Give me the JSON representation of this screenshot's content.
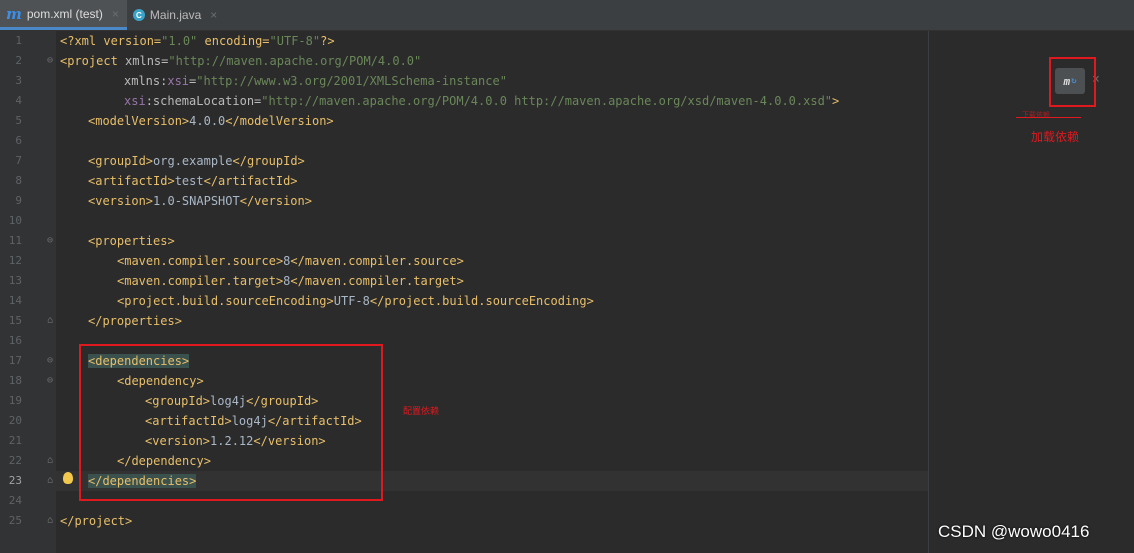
{
  "tabs": [
    {
      "label": "pom.xml (test)",
      "icon": "m"
    },
    {
      "label": "Main.java",
      "icon": "C"
    }
  ],
  "line_numbers": [
    "1",
    "2",
    "3",
    "4",
    "5",
    "6",
    "7",
    "8",
    "9",
    "10",
    "11",
    "12",
    "13",
    "14",
    "15",
    "16",
    "17",
    "18",
    "19",
    "20",
    "21",
    "22",
    "23",
    "24",
    "25"
  ],
  "code": {
    "l1_a": "<?xml version=",
    "l1_b": "\"1.0\"",
    "l1_c": " encoding=",
    "l1_d": "\"UTF-8\"",
    "l1_e": "?>",
    "l2_a": "<project ",
    "l2_b": "xmlns=",
    "l2_c": "\"http://maven.apache.org/POM/4.0.0\"",
    "l3_a": "xmlns:",
    "l3_b": "xsi",
    "l3_c": "=",
    "l3_d": "\"http://www.w3.org/2001/XMLSchema-instance\"",
    "l4_a": "xsi",
    "l4_b": ":schemaLocation=",
    "l4_c": "\"http://maven.apache.org/POM/4.0.0 http://maven.apache.org/xsd/maven-4.0.0.xsd\"",
    "l4_d": ">",
    "l5_a": "<modelVersion>",
    "l5_b": "4.0.0",
    "l5_c": "</modelVersion>",
    "l7_a": "<groupId>",
    "l7_b": "org.example",
    "l7_c": "</groupId>",
    "l8_a": "<artifactId>",
    "l8_b": "test",
    "l8_c": "</artifactId>",
    "l9_a": "<version>",
    "l9_b": "1.0-SNAPSHOT",
    "l9_c": "</version>",
    "l11": "<properties>",
    "l12_a": "<maven.compiler.source>",
    "l12_b": "8",
    "l12_c": "</maven.compiler.source>",
    "l13_a": "<maven.compiler.target>",
    "l13_b": "8",
    "l13_c": "</maven.compiler.target>",
    "l14_a": "<project.build.sourceEncoding>",
    "l14_b": "UTF-8",
    "l14_c": "</project.build.sourceEncoding>",
    "l15": "</properties>",
    "l17": "<dependencies>",
    "l18": "<dependency>",
    "l19_a": "<groupId>",
    "l19_b": "log4j",
    "l19_c": "</groupId>",
    "l20_a": "<artifactId>",
    "l20_b": "log4j",
    "l20_c": "</artifactId>",
    "l21_a": "<version>",
    "l21_b": "1.2.12",
    "l21_c": "</version>",
    "l22": "</dependency>",
    "l23": "</dependencies>",
    "l25": "</project>"
  },
  "annotations": {
    "config_deps": "配置依赖",
    "load_deps": "加载依赖",
    "load_deps_small": "下载依赖"
  },
  "maven_button": {
    "label": "m"
  },
  "watermark": "CSDN @wowo0416",
  "colors": {
    "red_annotation": "#e0191f",
    "tag": "#e8bf6a",
    "string": "#6a8759"
  }
}
